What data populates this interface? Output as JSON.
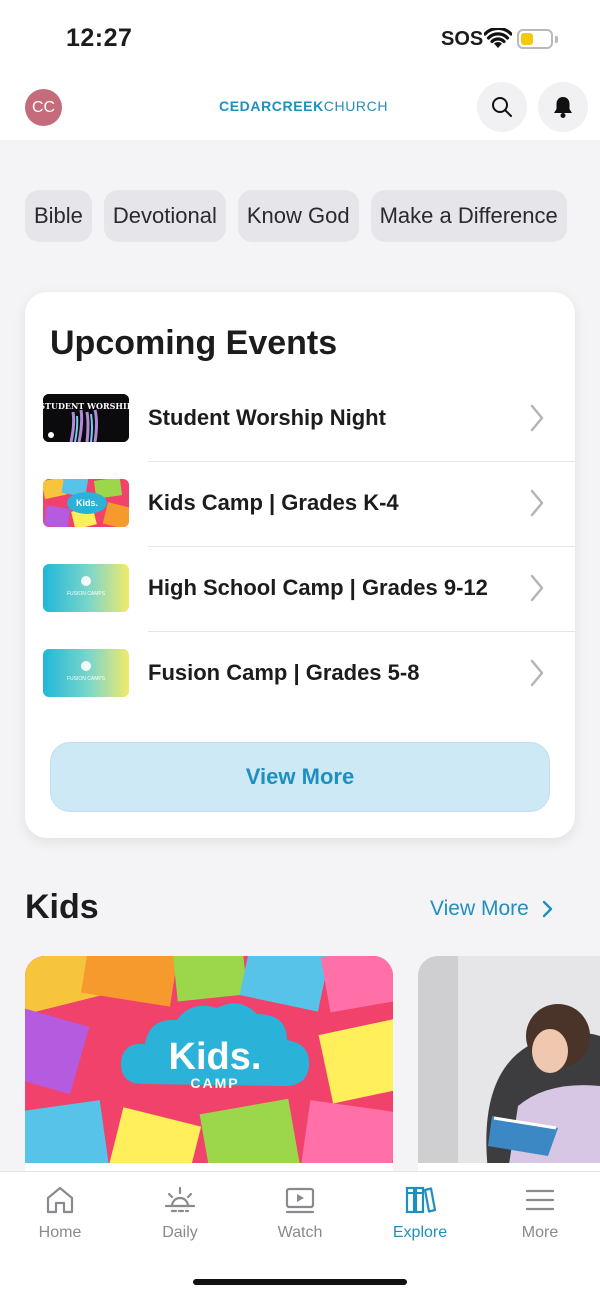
{
  "status_bar": {
    "time": "12:27",
    "sos": "SOS"
  },
  "header": {
    "avatar_initials": "CC",
    "brand_bold": "CEDARCREEK",
    "brand_light": "CHURCH"
  },
  "chips": [
    "Bible",
    "Devotional",
    "Know God",
    "Make a Difference"
  ],
  "upcoming_events": {
    "title": "Upcoming Events",
    "items": [
      {
        "label": "Student Worship Night"
      },
      {
        "label": "Kids Camp | Grades K-4"
      },
      {
        "label": "High School Camp | Grades 9-12"
      },
      {
        "label": "Fusion Camp | Grades 5-8"
      }
    ],
    "view_more": "View More"
  },
  "kids": {
    "title": "Kids",
    "view_more": "View More",
    "card1_logo": "Kids.",
    "card1_sub": "CAMP"
  },
  "thumbs": {
    "student_worship": "STUDENT WORSHIP",
    "kids_camp": "Kids.",
    "fusion": "FUSION CAMPS"
  },
  "tabs": [
    {
      "label": "Home",
      "icon": "home-icon"
    },
    {
      "label": "Daily",
      "icon": "sunrise-icon"
    },
    {
      "label": "Watch",
      "icon": "play-icon"
    },
    {
      "label": "Explore",
      "icon": "books-icon"
    },
    {
      "label": "More",
      "icon": "menu-icon"
    }
  ],
  "colors": {
    "accent": "#1f8fbf",
    "avatar": "#c46b7c",
    "button_bg": "#cde9f5"
  }
}
